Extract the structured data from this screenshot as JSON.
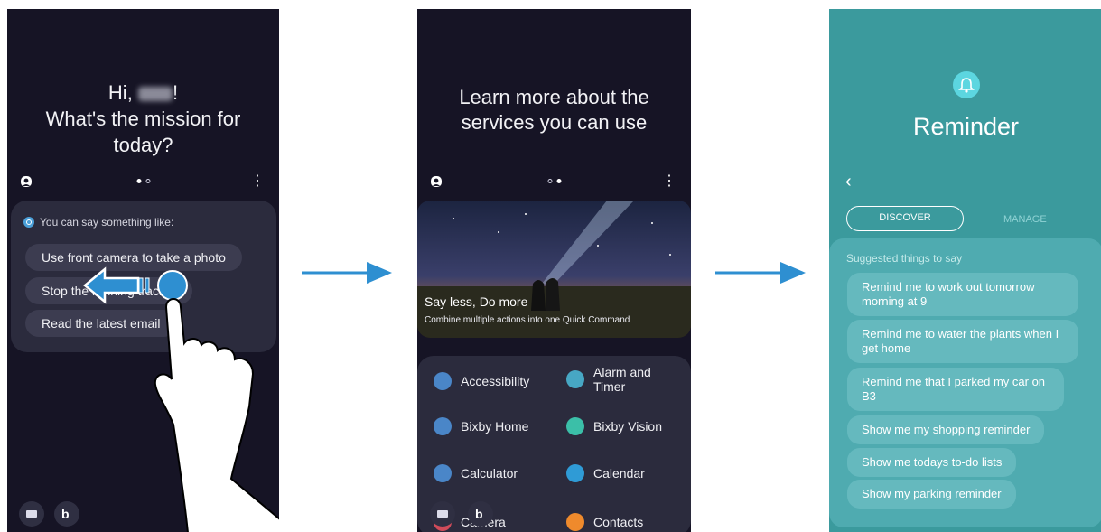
{
  "screen1": {
    "greeting_hi": "Hi,",
    "greeting_name_redacted": "",
    "greeting_bang": "!",
    "greeting_line2": "What's the mission for",
    "greeting_line3": "today?",
    "hint": "You can say something like:",
    "suggestions": [
      "Use front camera to take a photo",
      "Stop the running tracker",
      "Read the latest email"
    ]
  },
  "screen2": {
    "title_line1": "Learn more about the",
    "title_line2": "services you can use",
    "hero_title": "Say less, Do more",
    "hero_subtitle": "Combine multiple actions into one Quick Command",
    "services": [
      {
        "label": "Accessibility",
        "color": "#4a86c8"
      },
      {
        "label": "Alarm and Timer",
        "color": "#47a7c4"
      },
      {
        "label": "Bixby Home",
        "color": "#4a86c8"
      },
      {
        "label": "Bixby Vision",
        "color": "#3bbfa8"
      },
      {
        "label": "Calculator",
        "color": "#4a86c8"
      },
      {
        "label": "Calendar",
        "color": "#2f9bd6"
      },
      {
        "label": "Camera",
        "color": "#d14b5a"
      },
      {
        "label": "Contacts",
        "color": "#ef8a2c"
      }
    ]
  },
  "screen3": {
    "title": "Reminder",
    "tab_discover": "DISCOVER",
    "tab_manage": "MANAGE",
    "suggested_title": "Suggested things to say",
    "suggestions": [
      "Remind me to work out tomorrow morning at 9",
      "Remind me to water the plants when I get home",
      "Remind me that I parked my car on B3",
      "Show me my shopping reminder",
      "Show me todays to-do lists",
      "Show my parking reminder"
    ]
  },
  "colors": {
    "accent_blue": "#2e8fd1",
    "teal": "#3b9a9d",
    "dark_bg": "#161425"
  }
}
